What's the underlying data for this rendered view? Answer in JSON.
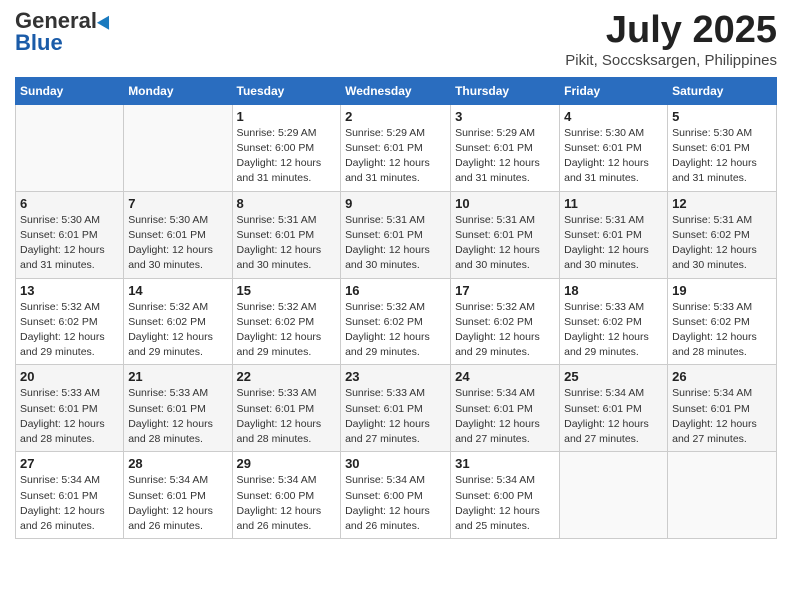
{
  "header": {
    "logo_general": "General",
    "logo_blue": "Blue",
    "month": "July 2025",
    "location": "Pikit, Soccsksargen, Philippines"
  },
  "days_of_week": [
    "Sunday",
    "Monday",
    "Tuesday",
    "Wednesday",
    "Thursday",
    "Friday",
    "Saturday"
  ],
  "weeks": [
    [
      {
        "day": "",
        "detail": ""
      },
      {
        "day": "",
        "detail": ""
      },
      {
        "day": "1",
        "detail": "Sunrise: 5:29 AM\nSunset: 6:00 PM\nDaylight: 12 hours and 31 minutes."
      },
      {
        "day": "2",
        "detail": "Sunrise: 5:29 AM\nSunset: 6:01 PM\nDaylight: 12 hours and 31 minutes."
      },
      {
        "day": "3",
        "detail": "Sunrise: 5:29 AM\nSunset: 6:01 PM\nDaylight: 12 hours and 31 minutes."
      },
      {
        "day": "4",
        "detail": "Sunrise: 5:30 AM\nSunset: 6:01 PM\nDaylight: 12 hours and 31 minutes."
      },
      {
        "day": "5",
        "detail": "Sunrise: 5:30 AM\nSunset: 6:01 PM\nDaylight: 12 hours and 31 minutes."
      }
    ],
    [
      {
        "day": "6",
        "detail": "Sunrise: 5:30 AM\nSunset: 6:01 PM\nDaylight: 12 hours and 31 minutes."
      },
      {
        "day": "7",
        "detail": "Sunrise: 5:30 AM\nSunset: 6:01 PM\nDaylight: 12 hours and 30 minutes."
      },
      {
        "day": "8",
        "detail": "Sunrise: 5:31 AM\nSunset: 6:01 PM\nDaylight: 12 hours and 30 minutes."
      },
      {
        "day": "9",
        "detail": "Sunrise: 5:31 AM\nSunset: 6:01 PM\nDaylight: 12 hours and 30 minutes."
      },
      {
        "day": "10",
        "detail": "Sunrise: 5:31 AM\nSunset: 6:01 PM\nDaylight: 12 hours and 30 minutes."
      },
      {
        "day": "11",
        "detail": "Sunrise: 5:31 AM\nSunset: 6:01 PM\nDaylight: 12 hours and 30 minutes."
      },
      {
        "day": "12",
        "detail": "Sunrise: 5:31 AM\nSunset: 6:02 PM\nDaylight: 12 hours and 30 minutes."
      }
    ],
    [
      {
        "day": "13",
        "detail": "Sunrise: 5:32 AM\nSunset: 6:02 PM\nDaylight: 12 hours and 29 minutes."
      },
      {
        "day": "14",
        "detail": "Sunrise: 5:32 AM\nSunset: 6:02 PM\nDaylight: 12 hours and 29 minutes."
      },
      {
        "day": "15",
        "detail": "Sunrise: 5:32 AM\nSunset: 6:02 PM\nDaylight: 12 hours and 29 minutes."
      },
      {
        "day": "16",
        "detail": "Sunrise: 5:32 AM\nSunset: 6:02 PM\nDaylight: 12 hours and 29 minutes."
      },
      {
        "day": "17",
        "detail": "Sunrise: 5:32 AM\nSunset: 6:02 PM\nDaylight: 12 hours and 29 minutes."
      },
      {
        "day": "18",
        "detail": "Sunrise: 5:33 AM\nSunset: 6:02 PM\nDaylight: 12 hours and 29 minutes."
      },
      {
        "day": "19",
        "detail": "Sunrise: 5:33 AM\nSunset: 6:02 PM\nDaylight: 12 hours and 28 minutes."
      }
    ],
    [
      {
        "day": "20",
        "detail": "Sunrise: 5:33 AM\nSunset: 6:01 PM\nDaylight: 12 hours and 28 minutes."
      },
      {
        "day": "21",
        "detail": "Sunrise: 5:33 AM\nSunset: 6:01 PM\nDaylight: 12 hours and 28 minutes."
      },
      {
        "day": "22",
        "detail": "Sunrise: 5:33 AM\nSunset: 6:01 PM\nDaylight: 12 hours and 28 minutes."
      },
      {
        "day": "23",
        "detail": "Sunrise: 5:33 AM\nSunset: 6:01 PM\nDaylight: 12 hours and 27 minutes."
      },
      {
        "day": "24",
        "detail": "Sunrise: 5:34 AM\nSunset: 6:01 PM\nDaylight: 12 hours and 27 minutes."
      },
      {
        "day": "25",
        "detail": "Sunrise: 5:34 AM\nSunset: 6:01 PM\nDaylight: 12 hours and 27 minutes."
      },
      {
        "day": "26",
        "detail": "Sunrise: 5:34 AM\nSunset: 6:01 PM\nDaylight: 12 hours and 27 minutes."
      }
    ],
    [
      {
        "day": "27",
        "detail": "Sunrise: 5:34 AM\nSunset: 6:01 PM\nDaylight: 12 hours and 26 minutes."
      },
      {
        "day": "28",
        "detail": "Sunrise: 5:34 AM\nSunset: 6:01 PM\nDaylight: 12 hours and 26 minutes."
      },
      {
        "day": "29",
        "detail": "Sunrise: 5:34 AM\nSunset: 6:00 PM\nDaylight: 12 hours and 26 minutes."
      },
      {
        "day": "30",
        "detail": "Sunrise: 5:34 AM\nSunset: 6:00 PM\nDaylight: 12 hours and 26 minutes."
      },
      {
        "day": "31",
        "detail": "Sunrise: 5:34 AM\nSunset: 6:00 PM\nDaylight: 12 hours and 25 minutes."
      },
      {
        "day": "",
        "detail": ""
      },
      {
        "day": "",
        "detail": ""
      }
    ]
  ]
}
